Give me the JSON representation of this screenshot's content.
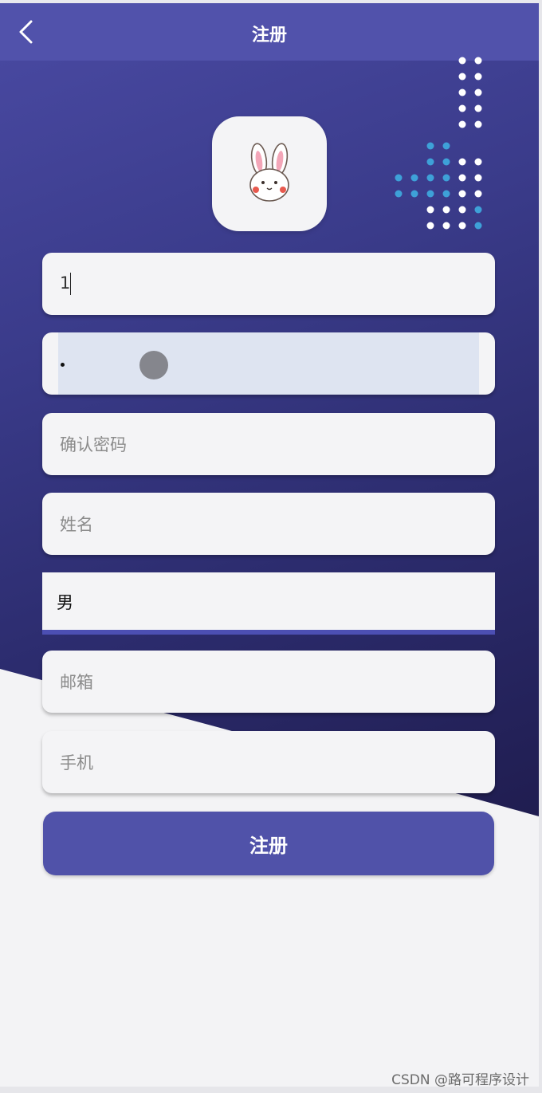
{
  "navbar": {
    "title": "注册",
    "back_icon": "chevron-left-icon"
  },
  "logo": {
    "icon": "rabbit-face-icon"
  },
  "form": {
    "username": {
      "value": "1"
    },
    "password": {
      "value": "•"
    },
    "confirm_password": {
      "placeholder": "确认密码"
    },
    "name": {
      "placeholder": "姓名"
    },
    "gender": {
      "value": "男"
    },
    "email": {
      "placeholder": "邮箱"
    },
    "phone": {
      "placeholder": "手机"
    }
  },
  "submit_label": "注册",
  "watermark": "CSDN @路可程序设计",
  "colors": {
    "primary": "#5152ab",
    "background_top": "#4a4aa3",
    "background_bottom": "#1f1c4e",
    "page": "#f3f3f5",
    "dot_blue": "#3ea1d8"
  }
}
